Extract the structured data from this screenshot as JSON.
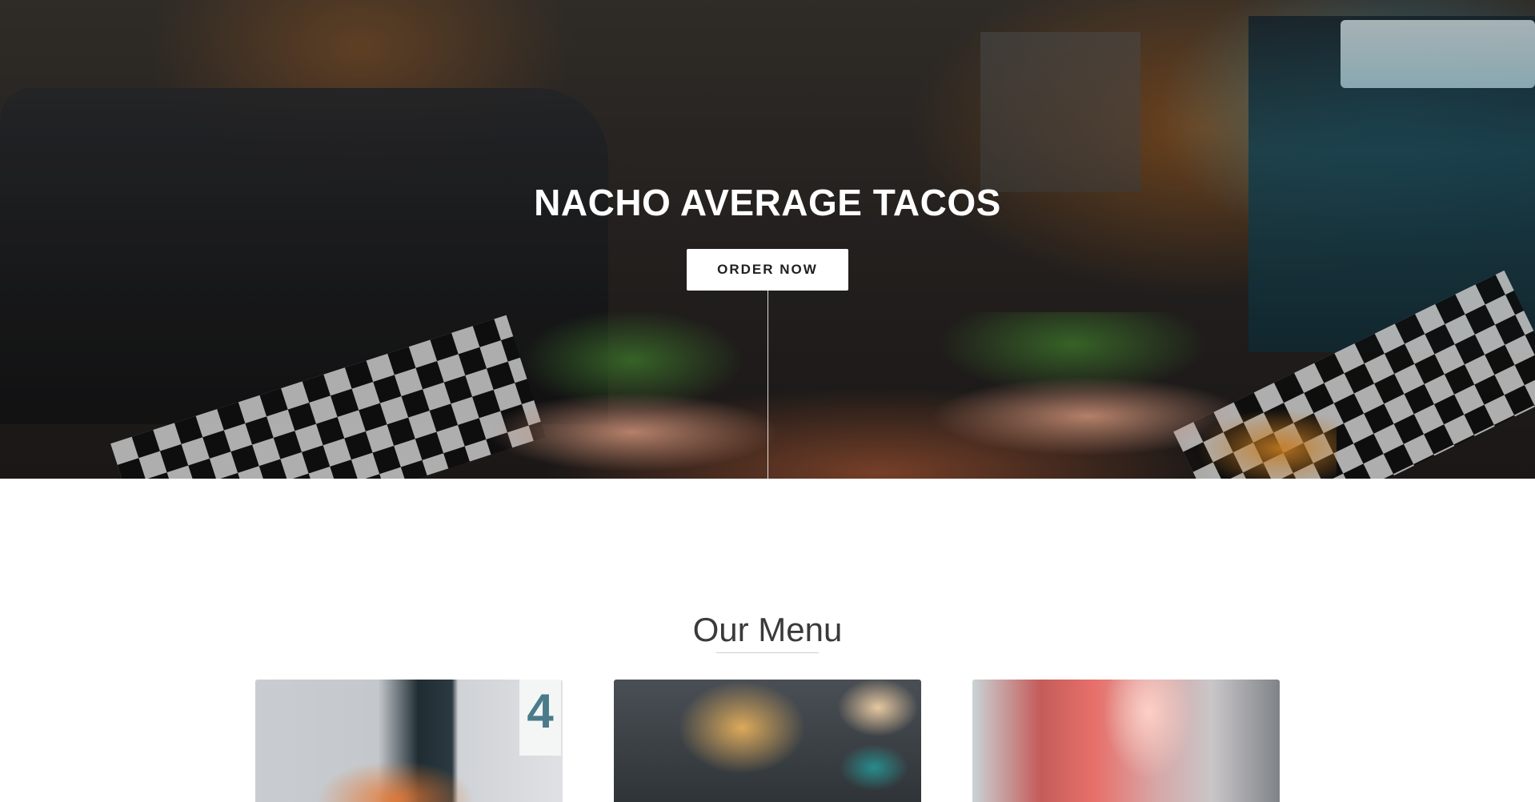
{
  "hero": {
    "title": "NACHO AVERAGE TACOS",
    "cta_label": "ORDER NOW"
  },
  "menu": {
    "title": "Our Menu",
    "cards": [
      {
        "badge": "4"
      },
      {},
      {}
    ]
  }
}
